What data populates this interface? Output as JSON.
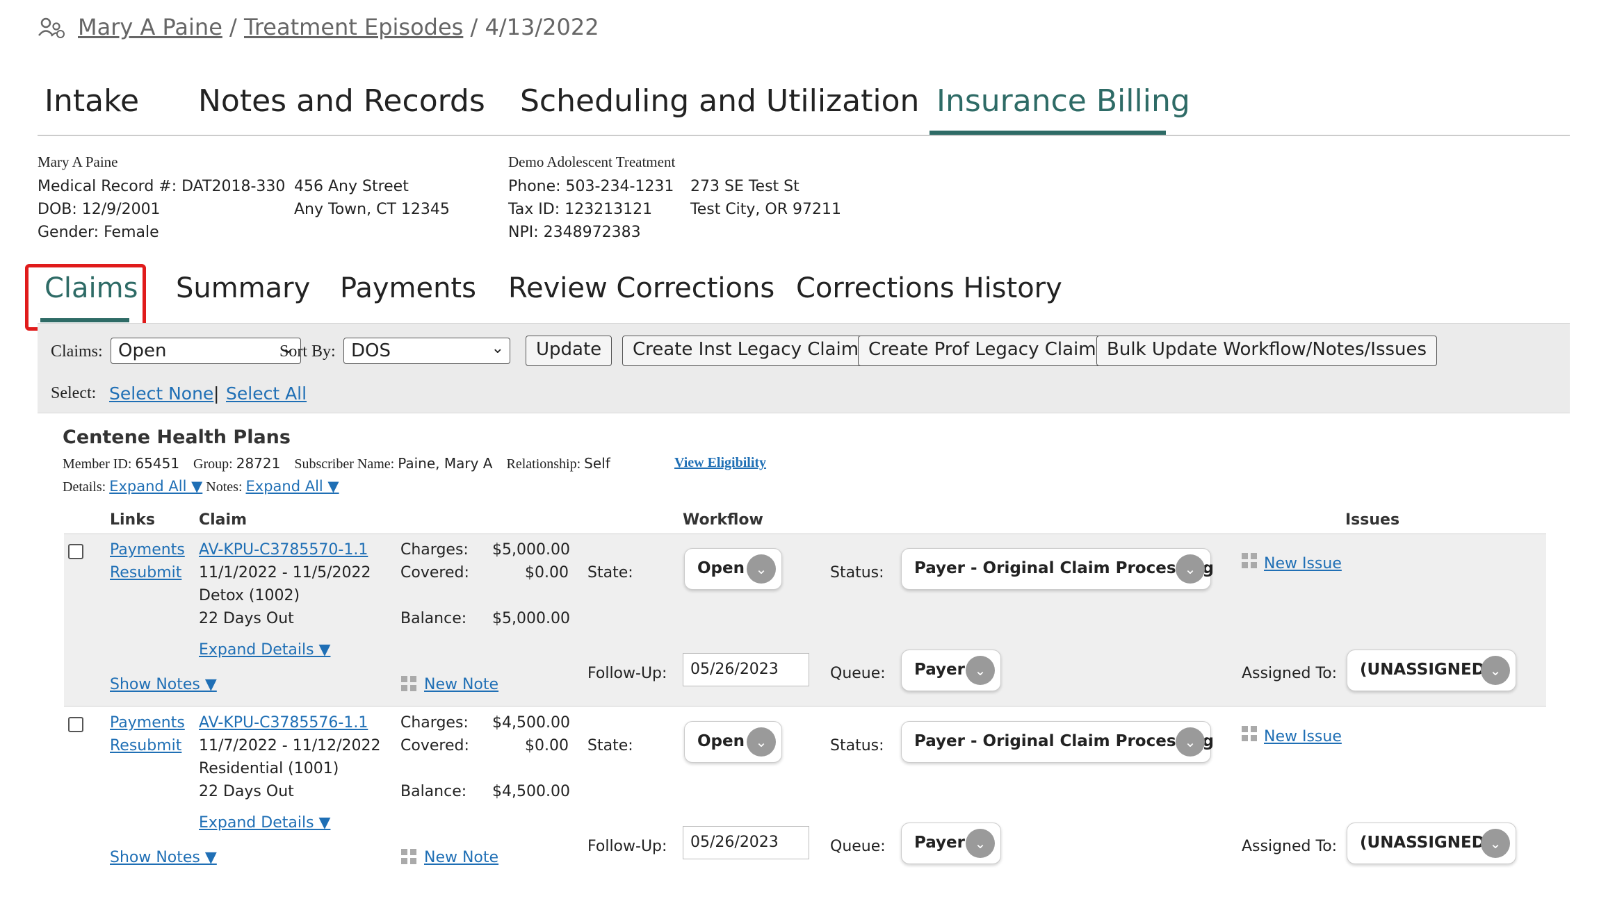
{
  "breadcrumb": {
    "patient": "Mary A Paine",
    "sep1": "/",
    "section": "Treatment Episodes",
    "sep2": "/",
    "date": "4/13/2022"
  },
  "top_tabs": [
    "Intake",
    "Notes and Records",
    "Scheduling and Utilization",
    "Insurance Billing"
  ],
  "patient": {
    "name": "Mary A Paine",
    "mrn": "Medical Record #: DAT2018-330",
    "dob": "DOB: 12/9/2001",
    "gender": "Gender: Female",
    "addr1": "456 Any Street",
    "addr2": "Any Town, CT 12345"
  },
  "provider": {
    "name": "Demo Adolescent Treatment",
    "phone": "Phone: 503-234-1231",
    "tax": "Tax ID: 123213121",
    "npi": "NPI: 2348972383",
    "addr1": "273 SE Test St",
    "addr2": "Test City, OR 97211"
  },
  "sub_tabs": [
    "Claims",
    "Summary",
    "Payments",
    "Review Corrections",
    "Corrections History"
  ],
  "toolbar": {
    "claims_label": "Claims:",
    "claims_value": "Open",
    "sort_label": "Sort By:",
    "sort_value": "DOS",
    "update": "Update",
    "inst": "Create Inst Legacy Claim",
    "prof": "Create Prof Legacy Claim",
    "bulk": "Bulk Update Workflow/Notes/Issues",
    "select_label": "Select:",
    "select_none": "Select None",
    "pipe": "|",
    "select_all": "Select All"
  },
  "plan": {
    "title": "Centene Health Plans",
    "member_label": "Member ID:",
    "member_value": "65451",
    "group_label": "Group:",
    "group_value": "28721",
    "subscriber_label": "Subscriber Name:",
    "subscriber_value": "Paine, Mary A",
    "rel_label": "Relationship:",
    "rel_value": "Self",
    "view_elig": "View Eligibility",
    "details_label": "Details:",
    "details_link": "Expand All ▼",
    "notes_label": "Notes:",
    "notes_link": "Expand All ▼"
  },
  "columns": {
    "links": "Links",
    "claim": "Claim",
    "workflow": "Workflow",
    "issues": "Issues"
  },
  "labels": {
    "payments": "Payments",
    "resubmit": "Resubmit",
    "charges": "Charges:",
    "covered": "Covered:",
    "balance": "Balance:",
    "state": "State:",
    "status": "Status:",
    "followup": "Follow-Up:",
    "queue": "Queue:",
    "assigned": "Assigned To:",
    "expand_details": "Expand Details ▼",
    "show_notes": "Show Notes ▼",
    "new_note": "New Note",
    "new_issue": "New Issue"
  },
  "claims": [
    {
      "id": "AV-KPU-C3785570-1.1",
      "dates": "11/1/2022 - 11/5/2022",
      "service": "Detox (1002)",
      "days": "22 Days Out",
      "charges": "$5,000.00",
      "covered": "$0.00",
      "balance": "$5,000.00",
      "state": "Open",
      "status": "Payer - Original Claim Processing",
      "followup": "05/26/2023",
      "queue": "Payer",
      "assigned": "(UNASSIGNED)"
    },
    {
      "id": "AV-KPU-C3785576-1.1",
      "dates": "11/7/2022 - 11/12/2022",
      "service": "Residential (1001)",
      "days": "22 Days Out",
      "charges": "$4,500.00",
      "covered": "$0.00",
      "balance": "$4,500.00",
      "state": "Open",
      "status": "Payer - Original Claim Processing",
      "followup": "05/26/2023",
      "queue": "Payer",
      "assigned": "(UNASSIGNED)"
    }
  ]
}
